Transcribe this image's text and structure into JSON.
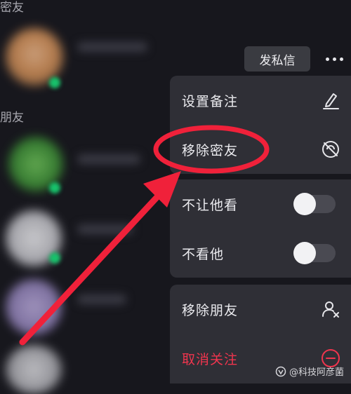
{
  "sections": {
    "close_friends": "密友",
    "friends": "朋友"
  },
  "actions": {
    "dm_label": "发私信"
  },
  "menu": {
    "set_remark": "设置备注",
    "remove_close_friend": "移除密友",
    "hide_from_them": "不让他看",
    "dont_see_them": "不看他",
    "remove_friend": "移除朋友",
    "unfollow": "取消关注"
  },
  "toggles": {
    "hide_from_them": false,
    "dont_see_them": false
  },
  "icons": {
    "set_remark": "pencil-icon",
    "remove_close_friend": "close-friend-off-icon",
    "remove_friend": "remove-user-icon",
    "unfollow": "unfollow-icon",
    "more": "more-dots-icon"
  },
  "watermark": {
    "text": "@科技阿彦菌"
  },
  "colors": {
    "background": "#17171d",
    "menu": "#2f2f36",
    "danger": "#f0354e",
    "annotation": "#f0213a",
    "online": "#17c26b"
  }
}
